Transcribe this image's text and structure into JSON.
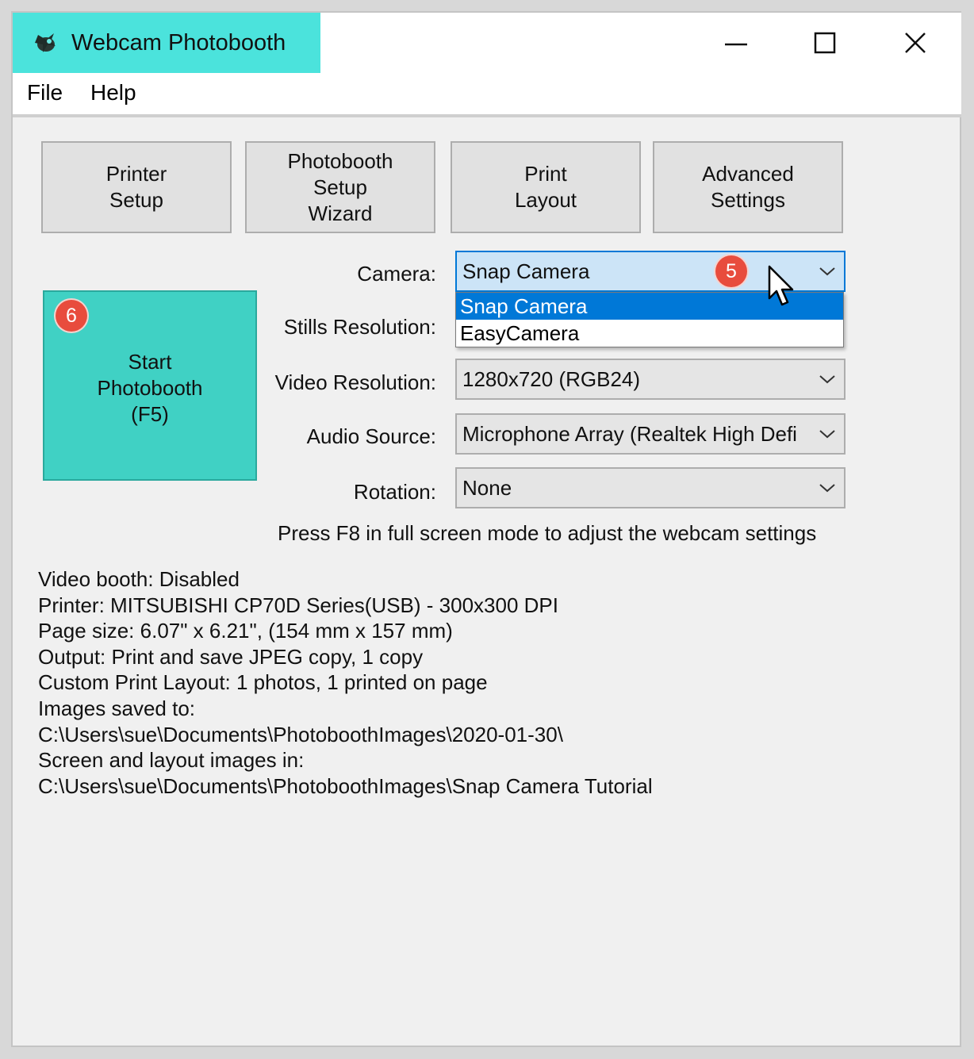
{
  "window": {
    "title": "Webcam Photobooth",
    "accent_color": "#4be3dc",
    "icons": [
      "app-icon",
      "minimize-icon",
      "maximize-icon",
      "close-icon"
    ]
  },
  "menu": {
    "items": [
      "File",
      "Help"
    ]
  },
  "toolbar": {
    "printer_setup": "Printer\nSetup",
    "setup_wizard": "Photobooth\nSetup\nWizard",
    "print_layout": "Print\nLayout",
    "advanced_settings": "Advanced\nSettings"
  },
  "start": {
    "label": "Start\nPhotobooth\n(F5)",
    "color": "#40d1c4"
  },
  "badges": {
    "camera": "5",
    "start": "6",
    "color": "#e84c3d"
  },
  "fields": {
    "camera": {
      "label": "Camera:",
      "value": "Snap Camera",
      "options": [
        "Snap Camera",
        "EasyCamera"
      ]
    },
    "stills_resolution": {
      "label": "Stills Resolution:"
    },
    "video_resolution": {
      "label": "Video Resolution:",
      "value": "1280x720 (RGB24)"
    },
    "audio_source": {
      "label": "Audio Source:",
      "value": "Microphone Array (Realtek High Defi"
    },
    "rotation": {
      "label": "Rotation:",
      "value": "None"
    }
  },
  "hint": "Press F8 in full screen mode to adjust the webcam settings",
  "info": {
    "lines": [
      "Video booth: Disabled",
      "Printer: MITSUBISHI CP70D Series(USB) - 300x300 DPI",
      "Page size: 6.07\" x 6.21\", (154 mm x 157 mm)",
      "Output: Print and save JPEG copy, 1 copy",
      "Custom Print Layout: 1 photos, 1 printed on page",
      "Images saved to:",
      "C:\\Users\\sue\\Documents\\PhotoboothImages\\2020-01-30\\",
      "Screen and layout images in:",
      "C:\\Users\\sue\\Documents\\PhotoboothImages\\Snap Camera Tutorial"
    ]
  }
}
